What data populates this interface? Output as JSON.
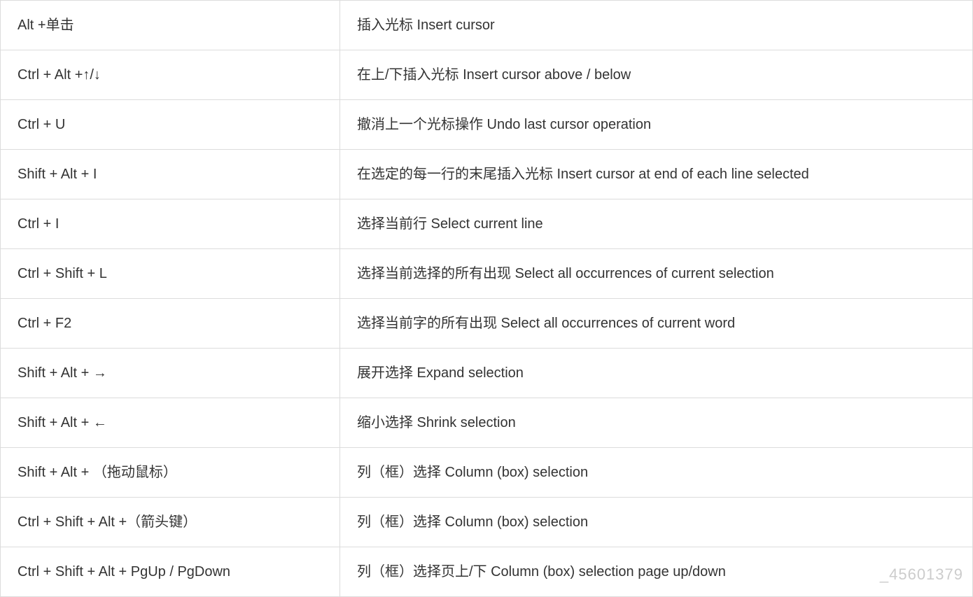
{
  "shortcuts": [
    {
      "keys": "Alt +单击",
      "description": "插入光标 Insert cursor"
    },
    {
      "keys": "Ctrl + Alt +↑/↓",
      "description": "在上/下插入光标 Insert cursor above / below"
    },
    {
      "keys": "Ctrl + U",
      "description": "撤消上一个光标操作 Undo last cursor operation"
    },
    {
      "keys": "Shift + Alt + I",
      "description": "在选定的每一行的末尾插入光标 Insert cursor at end of each line selected"
    },
    {
      "keys": "Ctrl + I",
      "description": "选择当前行 Select current line"
    },
    {
      "keys": "Ctrl + Shift + L",
      "description": "选择当前选择的所有出现 Select all occurrences of current selection"
    },
    {
      "keys": "Ctrl + F2",
      "description": "选择当前字的所有出现 Select all occurrences of current word"
    },
    {
      "keys": "Shift + Alt + →",
      "description": "展开选择 Expand selection"
    },
    {
      "keys": "Shift + Alt + ←",
      "description": "缩小选择 Shrink selection"
    },
    {
      "keys": "Shift + Alt + （拖动鼠标）",
      "description": "列（框）选择 Column (box) selection"
    },
    {
      "keys": "Ctrl + Shift + Alt +（箭头键）",
      "description": "列（框）选择 Column (box) selection"
    },
    {
      "keys": "Ctrl + Shift + Alt + PgUp / PgDown",
      "description": "列（框）选择页上/下 Column (box) selection page up/down"
    }
  ],
  "watermark": "_45601379"
}
